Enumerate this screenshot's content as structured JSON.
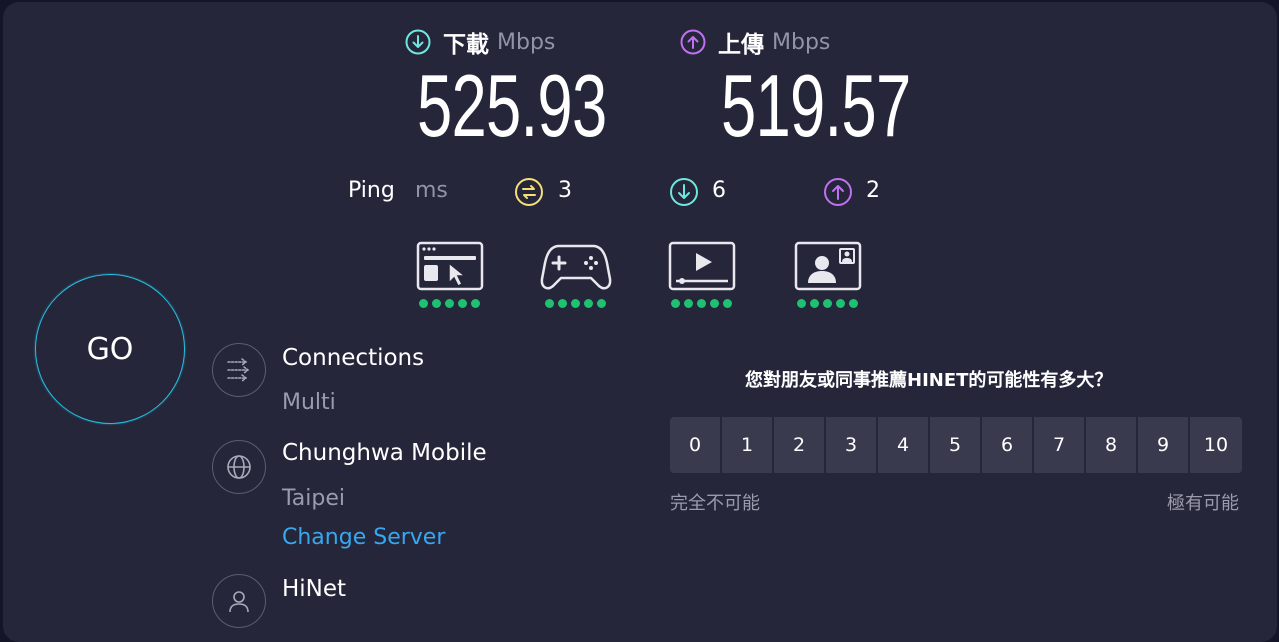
{
  "download": {
    "label": "下載",
    "unit": "Mbps",
    "value": "525.93",
    "icon": "download-arrow-icon",
    "color": "#6fe6df"
  },
  "upload": {
    "label": "上傳",
    "unit": "Mbps",
    "value": "519.57",
    "icon": "upload-arrow-icon",
    "color": "#bf71f0"
  },
  "ping": {
    "label": "Ping",
    "unit": "ms",
    "idle": "3",
    "down": "6",
    "up": "2",
    "idle_color": "#f4df7c",
    "down_color": "#6fe6df",
    "up_color": "#bf71f0"
  },
  "activities": [
    {
      "icon": "web-browsing-icon",
      "rating": 5
    },
    {
      "icon": "gaming-controller-icon",
      "rating": 5
    },
    {
      "icon": "video-streaming-icon",
      "rating": 5
    },
    {
      "icon": "video-chat-icon",
      "rating": 5
    }
  ],
  "go_button": {
    "label": "GO",
    "ring_color": "#27c0e0"
  },
  "connections": {
    "title": "Connections",
    "value": "Multi"
  },
  "server": {
    "title": "Chunghwa Mobile",
    "location": "Taipei",
    "change_label": "Change Server"
  },
  "provider": {
    "title": "HiNet"
  },
  "survey": {
    "question": "您對朋友或同事推薦HINET的可能性有多大？",
    "options": [
      "0",
      "1",
      "2",
      "3",
      "4",
      "5",
      "6",
      "7",
      "8",
      "9",
      "10"
    ],
    "low_label": "完全不可能",
    "high_label": "極有可能"
  }
}
